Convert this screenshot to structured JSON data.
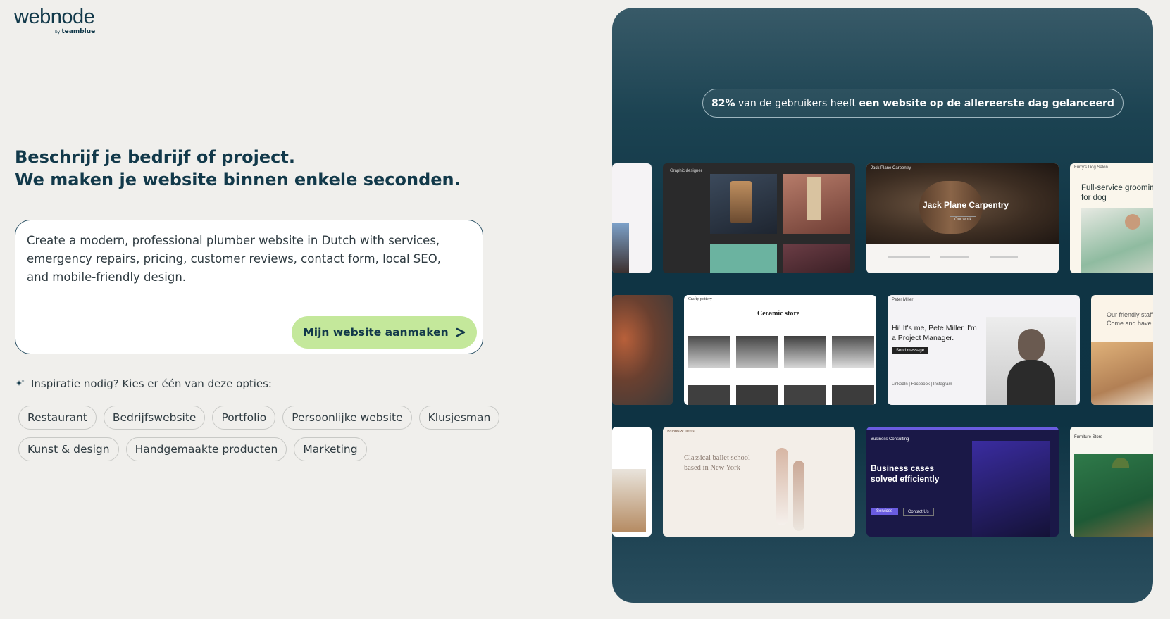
{
  "logo": {
    "word": "webnode",
    "by": "by",
    "brand": "teamblue"
  },
  "headline": {
    "line1": "Beschrijf je bedrijf of project.",
    "line2": "We maken je website binnen enkele seconden."
  },
  "prompt": {
    "value": "Create a modern, professional plumber website in Dutch with services, emergency repairs, pricing, customer reviews, contact form, local SEO, and mobile-friendly design.",
    "button_label": "Mijn website aanmaken",
    "button_icon": "arrow-right-icon"
  },
  "inspiration": {
    "icon": "sparkle-icon",
    "label": "Inspiratie nodig? Kies er één van deze opties:",
    "row1": [
      "Restaurant",
      "Bedrijfswebsite",
      "Portfolio",
      "Persoonlijke website",
      "Klusjesman"
    ],
    "row2": [
      "Kunst & design",
      "Handgemaakte producten",
      "Marketing"
    ]
  },
  "panel": {
    "stat_bold_1": "82%",
    "stat_text_1": " van de gebruikers heeft ",
    "stat_bold_2": "een website op de allereerste dag gelanceerd",
    "templates": {
      "graphic": {
        "title": "Graphic designer"
      },
      "carpentry": {
        "nav": "Jack Plane Carpentry",
        "hero": "Jack Plane Carpentry",
        "btn": "Our work"
      },
      "dog": {
        "nav": "Furry's Dog Salon",
        "hero": "Full-service grooming for dog"
      },
      "pottery": {
        "nav": "Crafty pottery",
        "hero": "Ceramic store"
      },
      "pm": {
        "nav": "Peter Miller",
        "hero": "Hi! It's me, Pete Miller. I'm a Project Manager.",
        "btn": "Send message",
        "links": "LinkedIn | Facebook | Instagram"
      },
      "friendly": {
        "hero": "Our friendly staff wi Come and have you"
      },
      "ballet": {
        "nav": "Pointes & Tutus",
        "hero": "Classical ballet school based in New York"
      },
      "consulting": {
        "nav": "Business Consulting",
        "hero": "Business cases solved efficiently",
        "btn1": "Services",
        "btn2": "Contact Us"
      },
      "furniture": {
        "nav": "Furniture Store"
      }
    }
  },
  "colors": {
    "background": "#f0efec",
    "primary_text": "#12394a",
    "cta": "#c4e89b",
    "panel": "#0f3444"
  }
}
